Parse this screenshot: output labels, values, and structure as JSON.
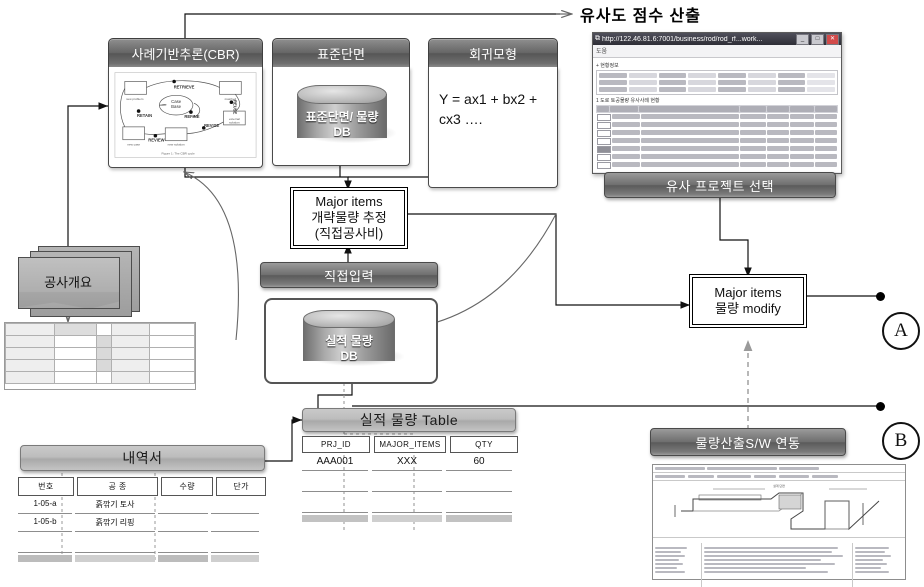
{
  "diagram": {
    "top_title": "유사도 점수 산출",
    "modules": [
      {
        "id": "cbr",
        "title": "사례기반추론(CBR)"
      },
      {
        "id": "std",
        "title": "표준단면"
      },
      {
        "id": "reg",
        "title": "회귀모형"
      }
    ],
    "cbr_cycle": {
      "center": "Case Base",
      "steps": [
        "RETRIEVE",
        "REUSE",
        "REVISE",
        "REVIEW",
        "RETAIN",
        "REFINE"
      ],
      "nodes": [
        "new problem",
        "matched case",
        "external solution",
        "new solution",
        "new case"
      ],
      "caption": "Figure 1: The CBR cycle"
    },
    "std_db_label": "표준단면/ 물량",
    "std_db_sub": "DB",
    "regression_formula": "Y = ax1 + bx2 + cx3 ….",
    "major_estimate": {
      "line1": "Major items",
      "line2": "개략물량 추정",
      "line3": "(직접공사비)"
    },
    "direct_input": "직접입력",
    "perf_db_label": "실적 물량",
    "perf_db_sub": "DB",
    "similar_project_select": "유사 프로젝트 선택",
    "major_modify": {
      "line1": "Major items",
      "line2": "물량 modify"
    },
    "qty_sw_link": "물량산출S/W 연동",
    "refs": [
      {
        "label": "A"
      },
      {
        "label": "B"
      }
    ],
    "project_outline": "공사개요",
    "statement_title": "내역서",
    "statement_table": {
      "columns": [
        "번호",
        "공 종",
        "수량",
        "단가"
      ],
      "rows": [
        {
          "번호": "1-05-a",
          "공 종": "흙깎기 토사",
          "수량": "",
          "단가": ""
        },
        {
          "번호": "1-05-b",
          "공 종": "흙깎기 리핑",
          "수량": "",
          "단가": ""
        }
      ]
    },
    "perf_table_title": "실적 물량 Table",
    "perf_table": {
      "columns": [
        "PRJ_ID",
        "MAJOR_ITEMS",
        "QTY"
      ],
      "rows": [
        {
          "PRJ_ID": "AAA001",
          "MAJOR_ITEMS": "XXX",
          "QTY": "60"
        }
      ]
    },
    "browser": {
      "title": "http://122.46.81.6:7001/business/rod/rod_rf...work...",
      "menu": "도움",
      "section1": "+ 현황정보",
      "section2": "1 도로 토공물량 유사사례 현황",
      "buttons": [
        "_",
        "□",
        "✕"
      ]
    },
    "colors": {
      "bar_dark": "#6e6e6e",
      "bar_light": "#bdbdbd",
      "line": "#222222",
      "dashed": "#9a9a9a",
      "page_bg": "#ffffff"
    }
  }
}
